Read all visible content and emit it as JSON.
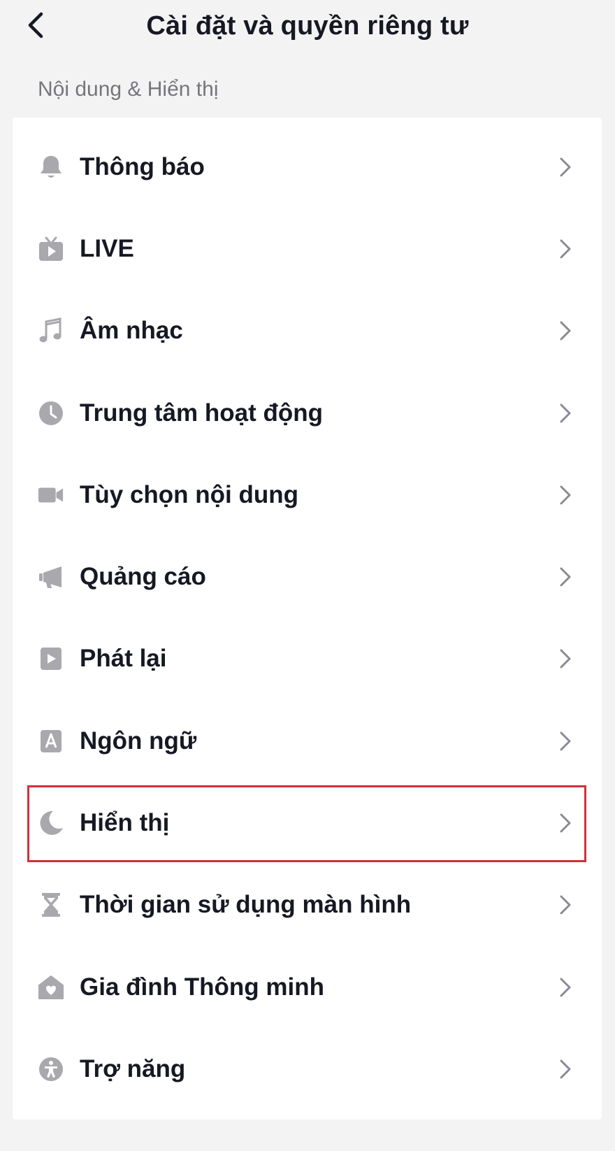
{
  "header": {
    "title": "Cài đặt và quyền riêng tư",
    "back_icon": "chevron-left-icon"
  },
  "section": {
    "label": "Nội dung & Hiển thị"
  },
  "items": [
    {
      "label": "Thông báo",
      "icon": "bell-icon"
    },
    {
      "label": "LIVE",
      "icon": "tv-icon"
    },
    {
      "label": "Âm nhạc",
      "icon": "music-note-icon"
    },
    {
      "label": "Trung tâm hoạt động",
      "icon": "clock-icon"
    },
    {
      "label": "Tùy chọn nội dung",
      "icon": "video-camera-icon"
    },
    {
      "label": "Quảng cáo",
      "icon": "megaphone-icon"
    },
    {
      "label": "Phát lại",
      "icon": "play-square-icon"
    },
    {
      "label": "Ngôn ngữ",
      "icon": "language-a-icon"
    },
    {
      "label": "Hiển thị",
      "icon": "moon-icon",
      "highlighted": true
    },
    {
      "label": "Thời gian sử dụng màn hình",
      "icon": "hourglass-icon"
    },
    {
      "label": "Gia đình Thông minh",
      "icon": "home-heart-icon"
    },
    {
      "label": "Trợ năng",
      "icon": "accessibility-icon"
    }
  ],
  "colors": {
    "icon_gray": "#a8a8ad",
    "chevron_gray": "#8a8b91",
    "highlight_border": "#d32f3a"
  }
}
